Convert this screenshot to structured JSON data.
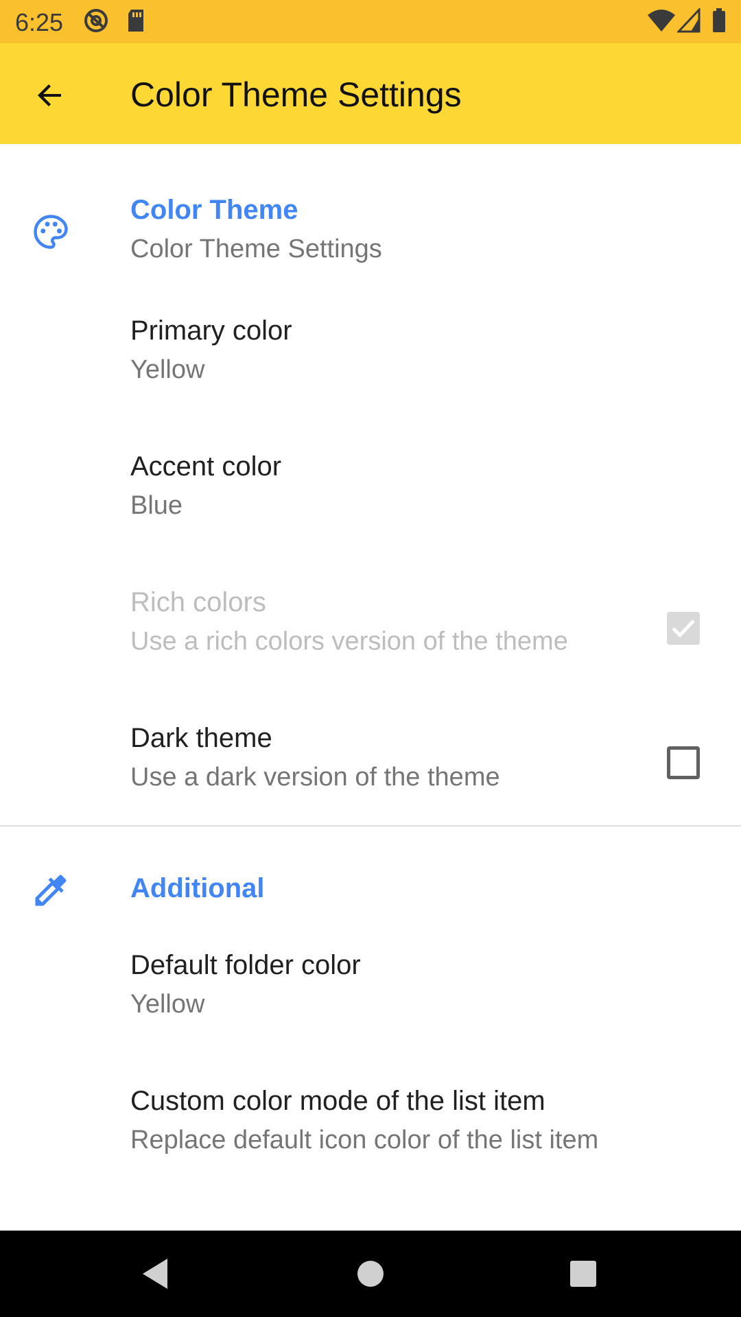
{
  "status_bar": {
    "time": "6:25"
  },
  "app_bar": {
    "title": "Color Theme Settings"
  },
  "sections": {
    "color_theme": {
      "title": "Color Theme",
      "summary": "Color Theme Settings",
      "icon": "palette-icon"
    },
    "additional": {
      "title": "Additional",
      "icon": "eyedropper-icon"
    }
  },
  "preferences": {
    "primary_color": {
      "title": "Primary color",
      "summary": "Yellow"
    },
    "accent_color": {
      "title": "Accent color",
      "summary": "Blue"
    },
    "rich_colors": {
      "title": "Rich colors",
      "summary": "Use a rich colors version of the theme",
      "checked": true,
      "enabled": false
    },
    "dark_theme": {
      "title": "Dark theme",
      "summary": "Use a dark version of the theme",
      "checked": false,
      "enabled": true
    },
    "default_folder_color": {
      "title": "Default folder color",
      "summary": "Yellow"
    },
    "custom_color_mode": {
      "title": "Custom color mode of the list item",
      "summary": "Replace default icon color of the list item"
    }
  },
  "colors": {
    "status_bar": "#FBC02D",
    "app_bar": "#FDD835",
    "accent": "#4285F4"
  }
}
